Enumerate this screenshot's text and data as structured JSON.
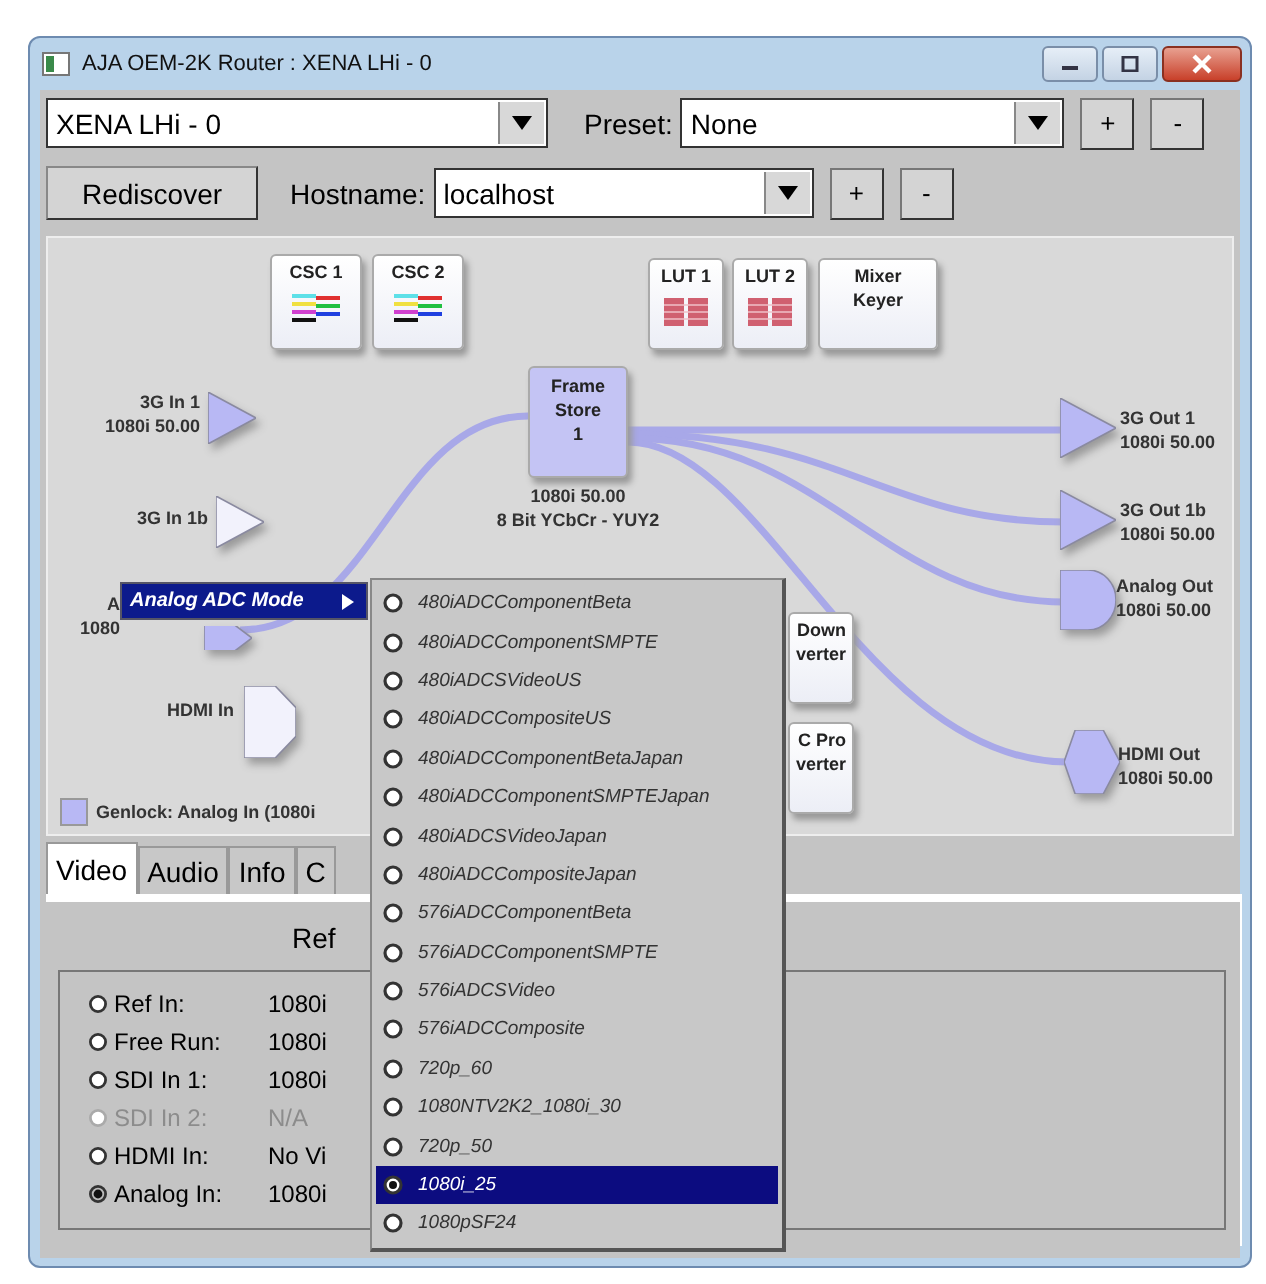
{
  "window": {
    "title": "AJA OEM-2K Router : XENA LHi  - 0"
  },
  "toolbar": {
    "device": "XENA LHi  - 0",
    "preset_label": "Preset:",
    "preset": "None",
    "preset_add": "+",
    "preset_remove": "-",
    "rediscover": "Rediscover",
    "hostname_label": "Hostname:",
    "hostname": "localhost",
    "host_add": "+",
    "host_remove": "-"
  },
  "diagram": {
    "nodes": [
      {
        "kind": "csc",
        "lines": [
          "CSC 1"
        ]
      },
      {
        "kind": "csc",
        "lines": [
          "CSC 2"
        ]
      },
      {
        "kind": "lut",
        "lines": [
          "LUT 1"
        ]
      },
      {
        "kind": "lut",
        "lines": [
          "LUT 2"
        ]
      },
      {
        "kind": "block",
        "lines": [
          "Mixer",
          "Keyer"
        ]
      },
      {
        "kind": "framestore",
        "lines": [
          "Frame",
          "Store",
          "1"
        ],
        "caption": [
          "1080i 50.00",
          "8 Bit YCbCr - YUY2"
        ]
      },
      {
        "kind": "input",
        "active": true,
        "lines": [
          "3G In 1",
          "1080i 50.00"
        ]
      },
      {
        "kind": "input",
        "active": false,
        "lines": [
          "3G In 1b"
        ]
      },
      {
        "kind": "input",
        "active": true,
        "lines": [
          "A",
          "1080"
        ]
      },
      {
        "kind": "hdmi_input",
        "active": false,
        "lines": [
          "HDMI In"
        ]
      },
      {
        "kind": "converter",
        "lines": [
          "Down",
          "verter"
        ]
      },
      {
        "kind": "converter",
        "lines": [
          "C Pro",
          "verter"
        ]
      },
      {
        "kind": "output",
        "active": true,
        "lines": [
          "3G Out 1",
          "1080i 50.00"
        ]
      },
      {
        "kind": "output",
        "active": true,
        "lines": [
          "3G Out 1b",
          "1080i 50.00"
        ]
      },
      {
        "kind": "analog_output",
        "active": true,
        "lines": [
          "Analog Out",
          "1080i 50.00"
        ]
      },
      {
        "kind": "hdmi_output",
        "active": true,
        "lines": [
          "HDMI Out",
          "1080i 50.00"
        ]
      }
    ],
    "genlock": "Genlock: Analog In (1080i"
  },
  "context_menu": {
    "label": "Analog ADC Mode",
    "items": [
      {
        "label": "480iADCComponentBeta",
        "selected": false
      },
      {
        "label": "480iADCComponentSMPTE",
        "selected": false
      },
      {
        "label": "480iADCSVideoUS",
        "selected": false
      },
      {
        "label": "480iADCCompositeUS",
        "selected": false
      },
      {
        "label": "480iADCComponentBetaJapan",
        "selected": false
      },
      {
        "label": "480iADCComponentSMPTEJapan",
        "selected": false
      },
      {
        "label": "480iADCSVideoJapan",
        "selected": false
      },
      {
        "label": "480iADCCompositeJapan",
        "selected": false
      },
      {
        "label": "576iADCComponentBeta",
        "selected": false
      },
      {
        "label": "576iADCComponentSMPTE",
        "selected": false
      },
      {
        "label": "576iADCSVideo",
        "selected": false
      },
      {
        "label": "576iADCComposite",
        "selected": false
      },
      {
        "label": "720p_60",
        "selected": false
      },
      {
        "label": "1080NTV2K2_1080i_30",
        "selected": false
      },
      {
        "label": "720p_50",
        "selected": false
      },
      {
        "label": "1080i_25",
        "selected": true
      },
      {
        "label": "1080pSF24",
        "selected": false
      }
    ]
  },
  "tabs": [
    {
      "label": "Video",
      "selected": true
    },
    {
      "label": "Audio",
      "selected": false
    },
    {
      "label": "Info",
      "selected": false
    },
    {
      "label": "C",
      "selected": false
    }
  ],
  "video_panel": {
    "title": "Ref",
    "rows": [
      {
        "label": "Ref In:",
        "value": "1080i",
        "selected": false,
        "disabled": false
      },
      {
        "label": "Free Run:",
        "value": "1080i",
        "selected": false,
        "disabled": false
      },
      {
        "label": "SDI In 1:",
        "value": "1080i",
        "selected": false,
        "disabled": false
      },
      {
        "label": "SDI In 2:",
        "value": "N/A",
        "selected": false,
        "disabled": true
      },
      {
        "label": "HDMI In:",
        "value": "No Vi",
        "selected": false,
        "disabled": false
      },
      {
        "label": "Analog In:",
        "value": "1080i",
        "selected": true,
        "disabled": false
      }
    ]
  }
}
